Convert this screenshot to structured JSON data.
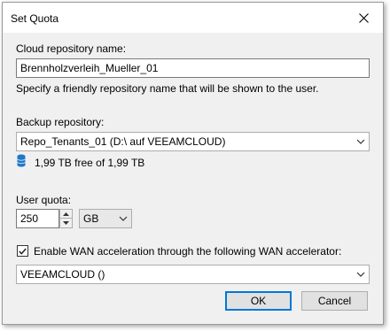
{
  "dialog": {
    "title": "Set Quota",
    "close_icon": "close-icon"
  },
  "repo_name": {
    "label": "Cloud repository name:",
    "value": "Brennholzverleih_Mueller_01",
    "hint": "Specify a friendly repository name that will be shown to the user."
  },
  "backup_repo": {
    "label": "Backup repository:",
    "selected": "Repo_Tenants_01 (D:\\ auf VEEAMCLOUD)",
    "free_space": "1,99 TB free of 1,99 TB",
    "icon": "database-icon"
  },
  "quota": {
    "label": "User quota:",
    "value": "250",
    "unit": "GB"
  },
  "wan": {
    "checked": true,
    "label": "Enable WAN acceleration through the following WAN accelerator:",
    "selected": "VEEAMCLOUD ()"
  },
  "buttons": {
    "ok": "OK",
    "cancel": "Cancel"
  },
  "colors": {
    "accent": "#0078d7",
    "database_icon": "#1f77c9"
  }
}
